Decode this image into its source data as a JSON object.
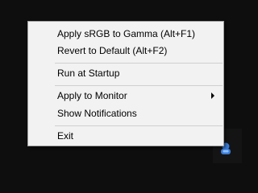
{
  "menu": {
    "items": [
      {
        "label": "Apply sRGB to Gamma (Alt+F1)"
      },
      {
        "label": "Revert to Default (Alt+F2)"
      },
      {
        "label": "Run at Startup"
      },
      {
        "label": "Apply to Monitor",
        "submenu": true
      },
      {
        "label": "Show Notifications"
      },
      {
        "label": "Exit"
      }
    ]
  },
  "tray": {
    "icon": "app-tray-icon",
    "icon_color": "#3a7bd5"
  },
  "colors": {
    "desktop": "#0e0e0e",
    "menu_bg": "#f2f2f2",
    "menu_border": "#a0a0a0",
    "separator": "#cfcfcf"
  }
}
